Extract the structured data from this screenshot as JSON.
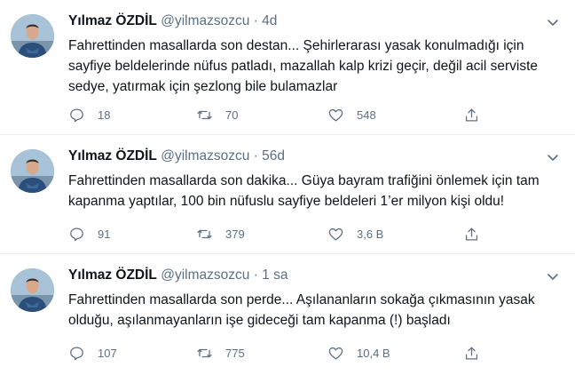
{
  "tweets": [
    {
      "name": "Yılmaz ÖZDİL",
      "handle": "@yilmazsozcu",
      "separator": "·",
      "time": "4d",
      "text": "Fahrettinden masallarda son destan... Şehirlerarası yasak konulmadığı için sayfiye beldelerinde nüfus patladı, mazallah kalp krizi geçir, değil acil serviste sedye, yatırmak için şezlong bile bulamazlar",
      "replies": "18",
      "retweets": "70",
      "likes": "548"
    },
    {
      "name": "Yılmaz ÖZDİL",
      "handle": "@yilmazsozcu",
      "separator": "·",
      "time": "56d",
      "text": "Fahrettinden masallarda son dakika... Güya bayram trafiğini önlemek için tam kapanma yaptılar, 100 bin nüfuslu sayfiye beldeleri 1’er milyon kişi oldu!",
      "replies": "91",
      "retweets": "379",
      "likes": "3,6 B"
    },
    {
      "name": "Yılmaz ÖZDİL",
      "handle": "@yilmazsozcu",
      "separator": "·",
      "time": "1 sa",
      "text": "Fahrettinden masallarda son perde... Aşılananların sokağa çıkmasının yasak olduğu, aşılanmayanların işe gideceği tam kapanma (!) başladı",
      "replies": "107",
      "retweets": "775",
      "likes": "10,4 B"
    }
  ],
  "icons": {
    "reply": "reply-icon",
    "retweet": "retweet-icon",
    "like": "heart-icon",
    "share": "share-icon",
    "more": "chevron-down-icon"
  },
  "colors": {
    "text": "#0f1419",
    "secondary": "#5b7083",
    "divider": "#ebeef0"
  }
}
